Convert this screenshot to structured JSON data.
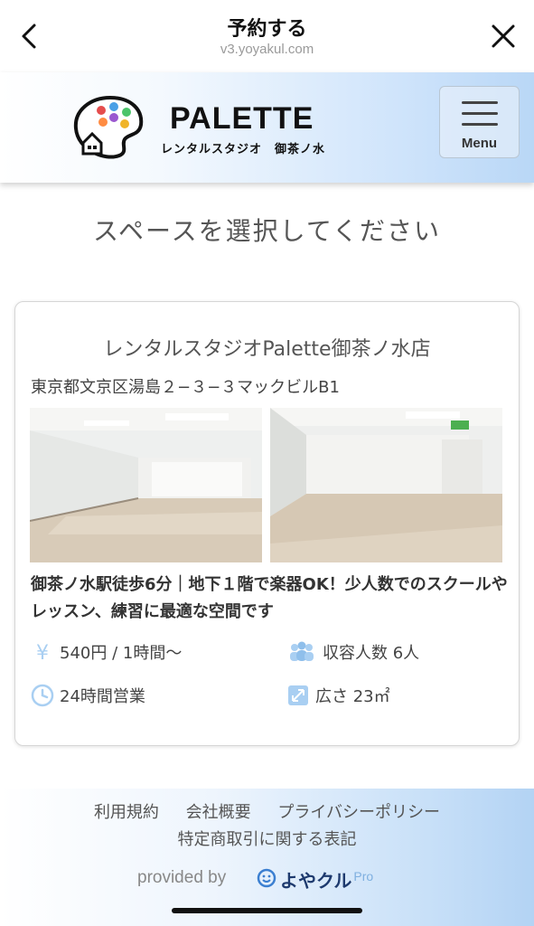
{
  "topbar": {
    "title": "予約する",
    "url": "v3.yoyakul.com",
    "back_icon": "chevron-left-icon",
    "close_icon": "close-icon"
  },
  "header": {
    "brand": "PALETTE",
    "brand_sub": "レンタルスタジオ　御茶ノ水",
    "menu_label": "Menu"
  },
  "page": {
    "heading": "スペースを選択してください"
  },
  "card": {
    "title": "レンタルスタジオPalette御茶ノ水店",
    "address": "東京都文京区湯島２−３−３マックビルB1",
    "description": "御茶ノ水駅徒歩6分｜地下１階で楽器OK！少人数でのスクールやレッスン、練習に最適な空間です",
    "price": "540円 / 1時間〜",
    "capacity": "収容人数 6人",
    "hours": "24時間営業",
    "area": "広さ 23㎡"
  },
  "footer": {
    "links": [
      "利用規約",
      "会社概要",
      "プライバシーポリシー"
    ],
    "link_tokusho": "特定商取引に関する表記",
    "provided_by": "provided by",
    "yoyaku_brand": "よやクル",
    "pro": "Pro"
  },
  "colors": {
    "header_gradient_end": "#b9d7f6",
    "icon_blue": "#a9cff2",
    "text": "#444444"
  }
}
